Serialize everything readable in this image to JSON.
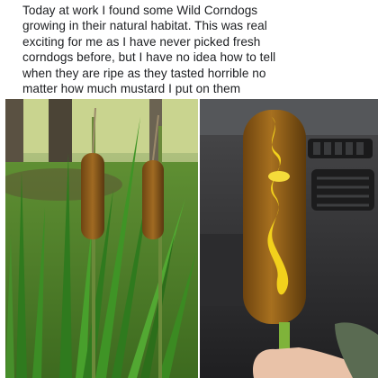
{
  "post": {
    "text_lines": [
      "Today at work I found some Wild Corndogs",
      "growing in their natural habitat. This was real",
      "exciting for me as I have never picked fresh",
      "corndogs before, but I have no idea how to tell",
      "when they are ripe as they tasted horrible no",
      "matter how much mustard I put on them"
    ]
  },
  "photos": [
    {
      "subject": "cattail-plants-photo"
    },
    {
      "subject": "corndog-with-mustard-photo"
    }
  ],
  "colors": {
    "text": "#1c1e21",
    "background": "#ffffff",
    "grass_green": "#3f8a2a",
    "corndog_brown": "#9a6418",
    "mustard_yellow": "#f2d11c",
    "car_interior": "#2a2a2c"
  }
}
